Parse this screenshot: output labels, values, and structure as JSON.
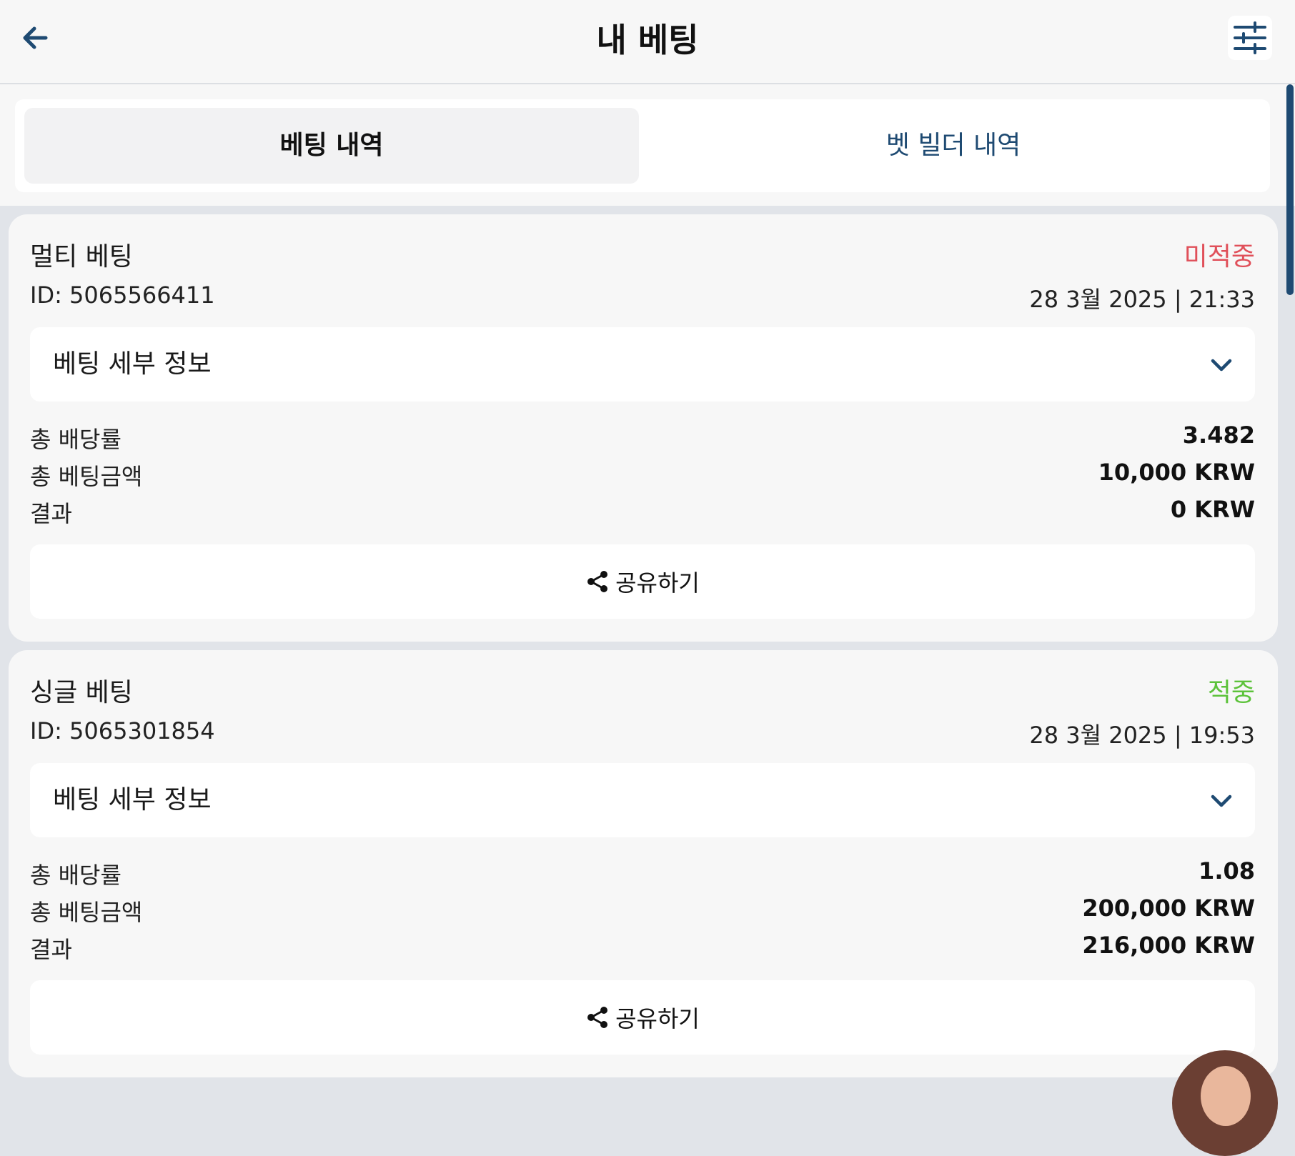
{
  "header": {
    "title": "내 베팅",
    "back_icon": "arrow-left-icon",
    "filter_icon": "sliders-icon"
  },
  "tabs": [
    {
      "label": "베팅 내역",
      "active": true
    },
    {
      "label": "벳 빌더 내역",
      "active": false
    }
  ],
  "bets": [
    {
      "type": "멀티 베팅",
      "status": "미적중",
      "status_color": "#e0505a",
      "id": "ID: 5065566411",
      "datetime": "28 3월 2025 | 21:33",
      "details_label": "베팅 세부 정보",
      "rows": [
        {
          "label": "총 배당률",
          "value": "3.482"
        },
        {
          "label": "총 베팅금액",
          "value": "10,000 KRW"
        },
        {
          "label": "결과",
          "value": "0 KRW"
        }
      ],
      "share_label": "공유하기"
    },
    {
      "type": "싱글 베팅",
      "status": "적중",
      "status_color": "#5cc23a",
      "id": "ID: 5065301854",
      "datetime": "28 3월 2025 | 19:53",
      "details_label": "베팅 세부 정보",
      "rows": [
        {
          "label": "총 배당률",
          "value": "1.08"
        },
        {
          "label": "총 베팅금액",
          "value": "200,000 KRW"
        },
        {
          "label": "결과",
          "value": "216,000 KRW"
        }
      ],
      "share_label": "공유하기"
    }
  ],
  "colors": {
    "accent": "#1e4a72",
    "lost": "#e0505a",
    "won": "#5cc23a"
  }
}
